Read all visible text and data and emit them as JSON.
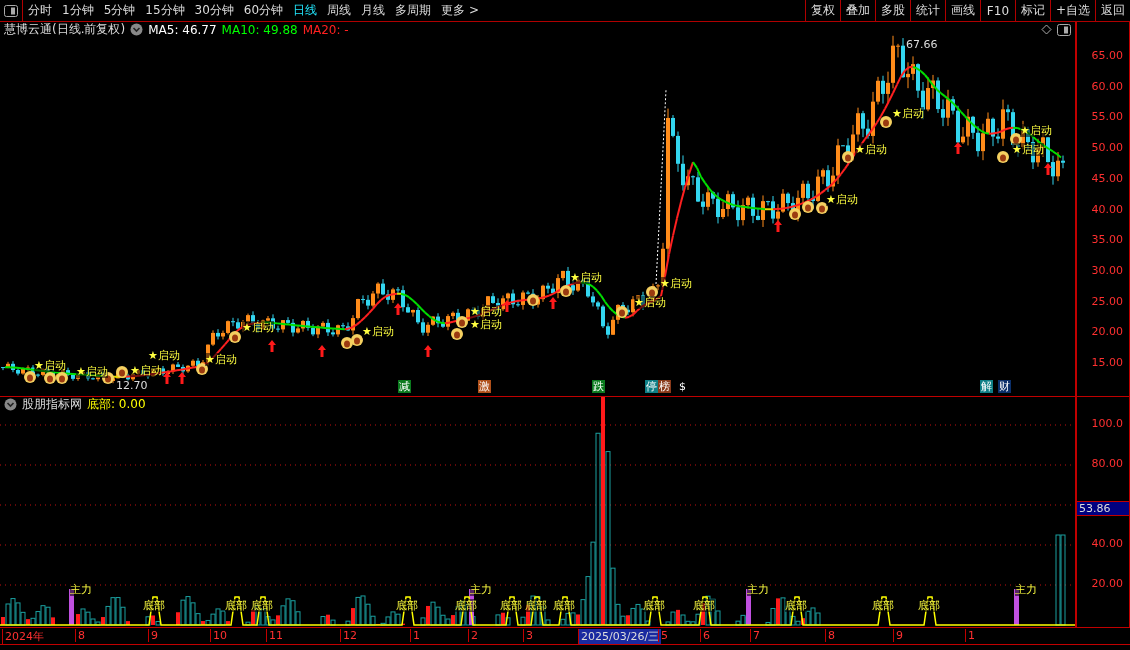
{
  "toolbar": {
    "periods": [
      {
        "label": "分时",
        "selected": false
      },
      {
        "label": "1分钟",
        "selected": false
      },
      {
        "label": "5分钟",
        "selected": false
      },
      {
        "label": "15分钟",
        "selected": false
      },
      {
        "label": "30分钟",
        "selected": false
      },
      {
        "label": "60分钟",
        "selected": false
      },
      {
        "label": "日线",
        "selected": true
      },
      {
        "label": "周线",
        "selected": false
      },
      {
        "label": "月线",
        "selected": false
      },
      {
        "label": "多周期",
        "selected": false
      },
      {
        "label": "更多 >",
        "selected": false
      }
    ],
    "actions": [
      "复权",
      "叠加",
      "多股",
      "统计",
      "画线",
      "F10",
      "标记",
      "+自选",
      "返回"
    ]
  },
  "main_panel": {
    "title": "慧博云通(日线.前复权)",
    "indicators": [
      {
        "label": "MA5: 46.77",
        "color": "#ffffff"
      },
      {
        "label": "MA10: 49.88",
        "color": "#00ff00"
      },
      {
        "label": "MA20: -",
        "color": "#ff2020"
      }
    ],
    "y_axis": [
      "65.00",
      "60.00",
      "55.00",
      "50.00",
      "45.00",
      "40.00",
      "35.00",
      "30.00",
      "25.00",
      "20.00",
      "15.00"
    ],
    "high_label": "67.66",
    "low_label": "12.70",
    "signals": [
      "★启动",
      "★启动",
      "★启动",
      "★启动",
      "★启动",
      "★启动",
      "★启动",
      "★启动",
      "★启动",
      "★启动",
      "★启动",
      "★启动",
      "★启动",
      "★启动",
      "★启动",
      "★启动",
      "★启动"
    ],
    "event_tags": [
      {
        "text": "减",
        "color": "#0b7a1e"
      },
      {
        "text": "激",
        "color": "#b0501a"
      },
      {
        "text": "跌",
        "color": "#0b7a1e"
      },
      {
        "text": "停",
        "color": "#0e7f86"
      },
      {
        "text": "榜",
        "color": "#8a3a1a"
      },
      {
        "text": "$",
        "color": "#000000"
      },
      {
        "text": "解",
        "color": "#0e7f86"
      },
      {
        "text": "财",
        "color": "#0b2f6a"
      }
    ]
  },
  "indicator_panel": {
    "title": "股朋指标网",
    "reading": "底部: 0.00",
    "y_axis": [
      "100.0",
      "80.00",
      "40.00",
      "20.00"
    ],
    "cursor_value": "53.86",
    "markers": [
      {
        "kind": "main_force",
        "text": "主力"
      },
      {
        "kind": "bottom",
        "text": "底部"
      },
      {
        "kind": "bottom",
        "text": "底部"
      },
      {
        "kind": "bottom",
        "text": "底部"
      },
      {
        "kind": "bottom",
        "text": "底部"
      },
      {
        "kind": "bottom",
        "text": "底部"
      },
      {
        "kind": "main_force",
        "text": "主力"
      },
      {
        "kind": "bottom",
        "text": "底部"
      },
      {
        "kind": "bottom",
        "text": "底部"
      },
      {
        "kind": "bottom",
        "text": "底部"
      },
      {
        "kind": "bottom",
        "text": "底部"
      },
      {
        "kind": "bottom",
        "text": "底部"
      },
      {
        "kind": "main_force",
        "text": "主力"
      },
      {
        "kind": "bottom",
        "text": "底部"
      },
      {
        "kind": "bottom",
        "text": "底部"
      },
      {
        "kind": "bottom",
        "text": "底部"
      },
      {
        "kind": "main_force",
        "text": "主力"
      }
    ]
  },
  "x_axis": [
    {
      "text": "2024年",
      "selected": false
    },
    {
      "text": "8",
      "selected": false
    },
    {
      "text": "9",
      "selected": false
    },
    {
      "text": "10",
      "selected": false
    },
    {
      "text": "11",
      "selected": false
    },
    {
      "text": "12",
      "selected": false
    },
    {
      "text": "1",
      "selected": false
    },
    {
      "text": "2",
      "selected": false
    },
    {
      "text": "3",
      "selected": false
    },
    {
      "text": "2025/03/26/三",
      "selected": true
    },
    {
      "text": "5",
      "selected": false
    },
    {
      "text": "6",
      "selected": false
    },
    {
      "text": "7",
      "selected": false
    },
    {
      "text": "8",
      "selected": false
    },
    {
      "text": "9",
      "selected": false
    },
    {
      "text": "1",
      "selected": false
    }
  ]
}
